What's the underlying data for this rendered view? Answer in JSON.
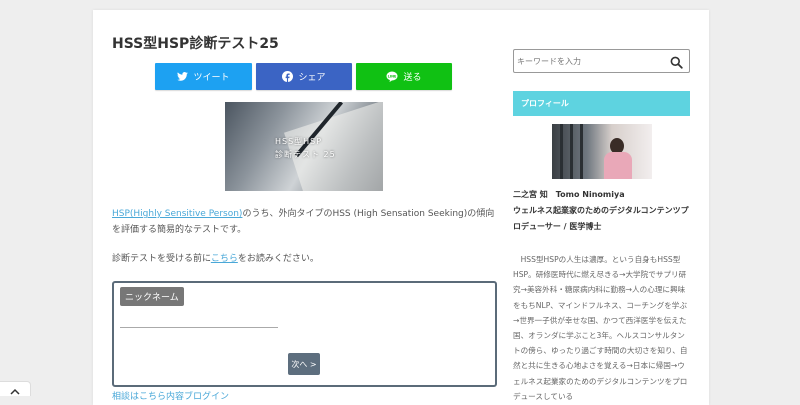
{
  "page_title": "HSS型HSP診断テスト25",
  "share": {
    "twitter_label": "ツイート",
    "facebook_label": "シェア",
    "line_label": "送る"
  },
  "thumbnail": {
    "line1": "HSS型HSP",
    "line2": "診断テスト 25"
  },
  "intro": {
    "link_text": "HSP(Highly Sensitive Person)",
    "text": "のうち、外向タイプのHSS (High Sensation Seeking)の傾向を評価する簡易的なテストです。"
  },
  "before_test": {
    "prefix": "診断テストを受ける前に",
    "link_text": "こちら",
    "suffix": "をお読みください。"
  },
  "form": {
    "nickname_label": "ニックネーム",
    "nickname_value": "",
    "next_button": "次へ >"
  },
  "cut_link": "相談はこちら内容ブログイン",
  "sidebar": {
    "search_placeholder": "キーワードを入力",
    "profile_heading": "プロフィール",
    "profile_name": "二之宮 知　Tomo Ninomiya",
    "profile_role": "ウェルネス起業家のためのデジタルコンテンツプロデューサー / 医学博士",
    "profile_bio": "　HSS型HSPの人生は濃厚。という自身もHSS型HSP。研修医時代に燃え尽きる→大学院でサプリ研究→美容外科・糖尿病内科に勤務→人の心理に興味をもちNLP、マインドフルネス、コーチングを学ぶ→世界一子供が幸せな国、かつて西洋医学を伝えた国、オランダに学ぶこと3年。ヘルスコンサルタントの傍ら、ゆったり過ごす時間の大切さを知り、自然と共に生きる心地よさを覚える→日本に帰国→ウェルネス起業家のためのデジタルコンテンツをプロデュースしている"
  },
  "colors": {
    "twitter": "#1da1f2",
    "facebook": "#3b64c4",
    "line": "#10c113",
    "profile_heading": "#5ed3e0",
    "link": "#4aa8d8"
  }
}
